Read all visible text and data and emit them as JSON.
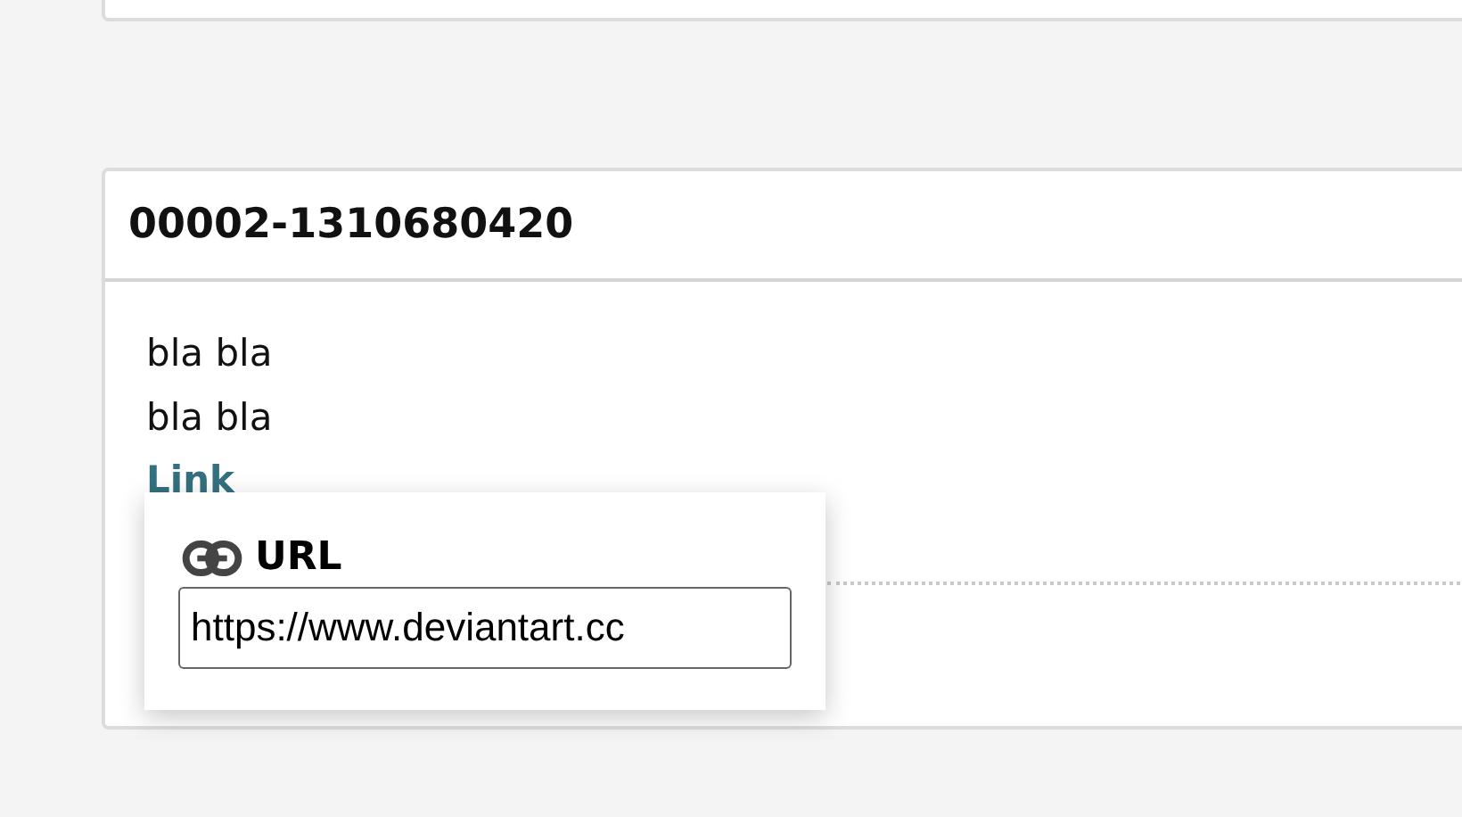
{
  "card": {
    "title": "00002-1310680420",
    "lines": [
      "bla bla",
      "bla bla"
    ],
    "link": "Link"
  },
  "popup": {
    "label": "URL",
    "value": "https://www.deviantart.cc"
  }
}
